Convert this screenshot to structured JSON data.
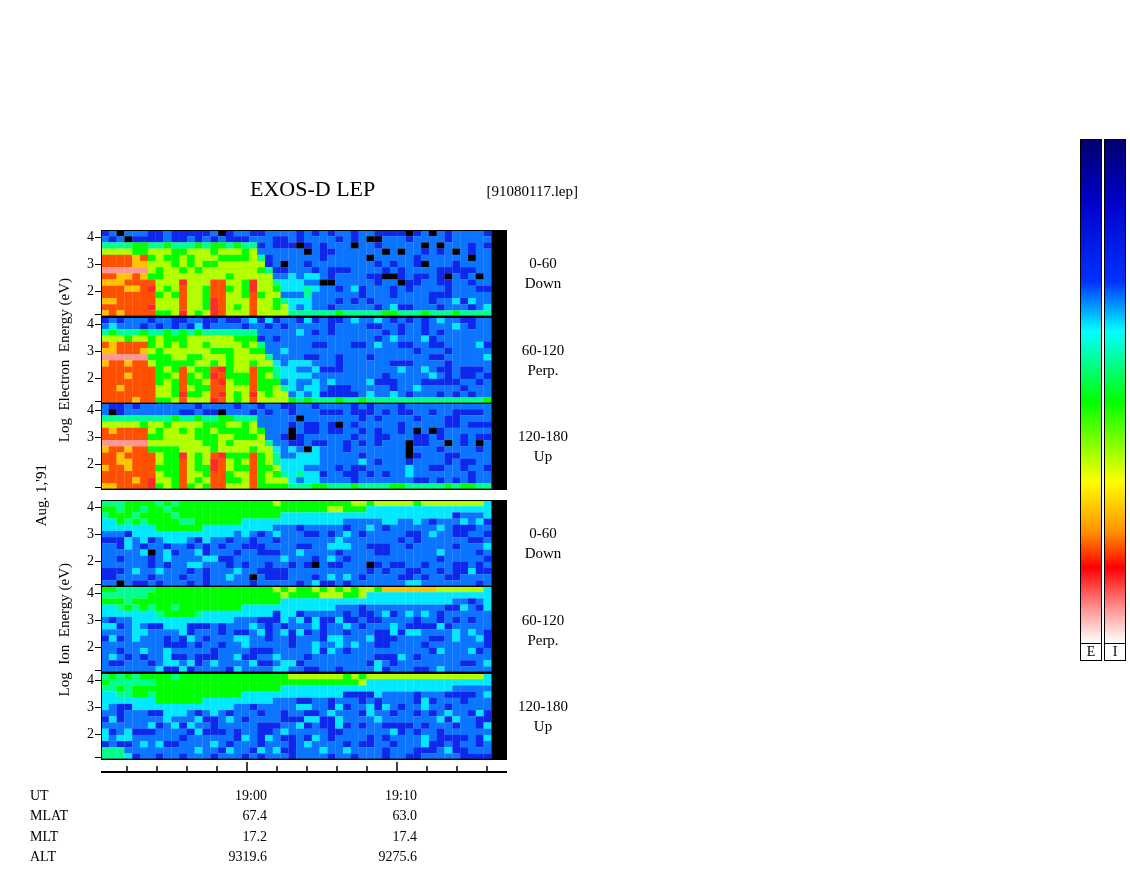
{
  "title": "EXOS-D LEP",
  "file": "[91080117.lep]",
  "date": "Aug. 1,'91",
  "groups": [
    {
      "kind": "electron",
      "ylabel": "Log  Electron  Energy (eV)",
      "panels": [
        {
          "range": "0-60",
          "direction": "Down",
          "yticks": [
            "4",
            "3",
            "2"
          ]
        },
        {
          "range": "60-120",
          "direction": "Perp.",
          "yticks": [
            "4",
            "3",
            "2"
          ]
        },
        {
          "range": "120-180",
          "direction": "Up",
          "yticks": [
            "4",
            "3",
            "2"
          ]
        }
      ]
    },
    {
      "kind": "ion",
      "ylabel": "Log  Ion  Energy (eV)",
      "panels": [
        {
          "range": "0-60",
          "direction": "Down",
          "yticks": [
            "4",
            "3",
            "2"
          ]
        },
        {
          "range": "60-120",
          "direction": "Perp.",
          "yticks": [
            "4",
            "3",
            "2"
          ]
        },
        {
          "range": "120-180",
          "direction": "Up",
          "yticks": [
            "4",
            "3",
            "2"
          ]
        }
      ]
    }
  ],
  "time_axis": {
    "rows": [
      {
        "label": "UT",
        "values": [
          "19:00",
          "19:10"
        ]
      },
      {
        "label": "MLAT",
        "values": [
          "67.4",
          "63.0"
        ]
      },
      {
        "label": "MLT",
        "values": [
          "17.2",
          "17.4"
        ]
      },
      {
        "label": "ALT",
        "values": [
          "9319.6",
          "9275.6"
        ]
      }
    ]
  },
  "color_bars": [
    {
      "label": "E"
    },
    {
      "label": "I"
    }
  ]
}
